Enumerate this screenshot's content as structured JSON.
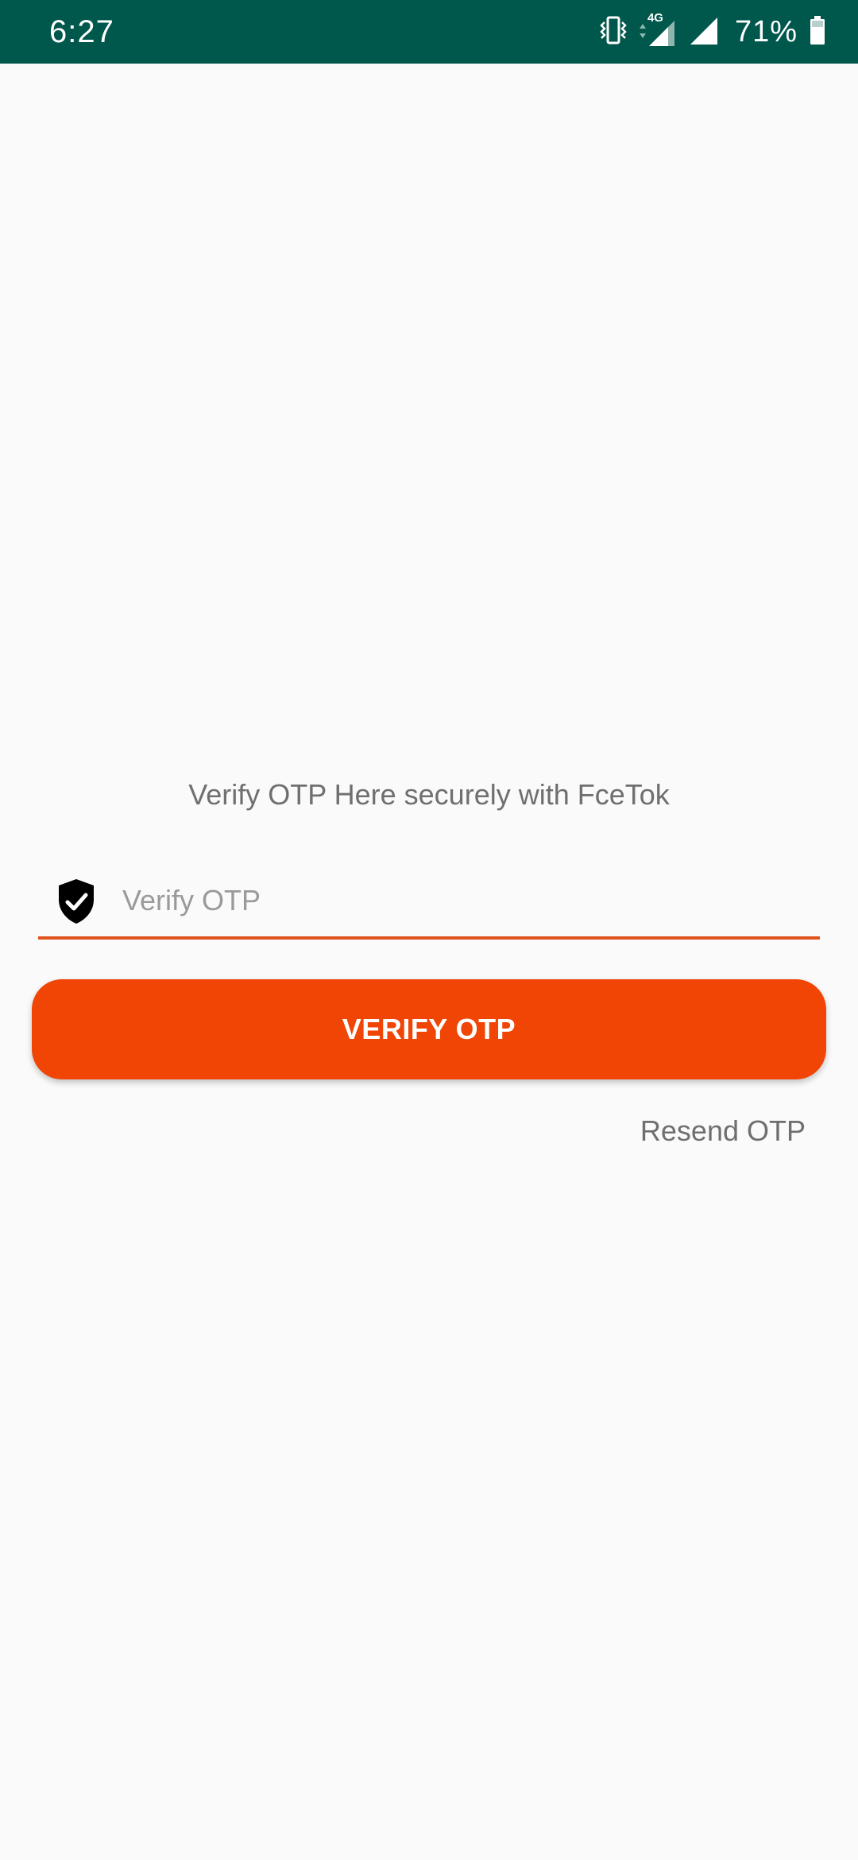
{
  "status_bar": {
    "time": "6:27",
    "network_type": "4G",
    "battery_percent": "71%",
    "background_color": "#00574b",
    "icons": [
      "vibrate-icon",
      "data-arrows-icon",
      "signal-4g-icon",
      "signal-icon",
      "battery-icon"
    ]
  },
  "main": {
    "subtitle": "Verify OTP Here securely with FceTok",
    "otp_field": {
      "value": "",
      "placeholder": "Verify OTP",
      "icon": "shield-check-icon",
      "underline_color": "#e0521b"
    },
    "verify_button": {
      "label": "VERIFY OTP",
      "color": "#f04505"
    },
    "resend_link": "Resend OTP"
  }
}
